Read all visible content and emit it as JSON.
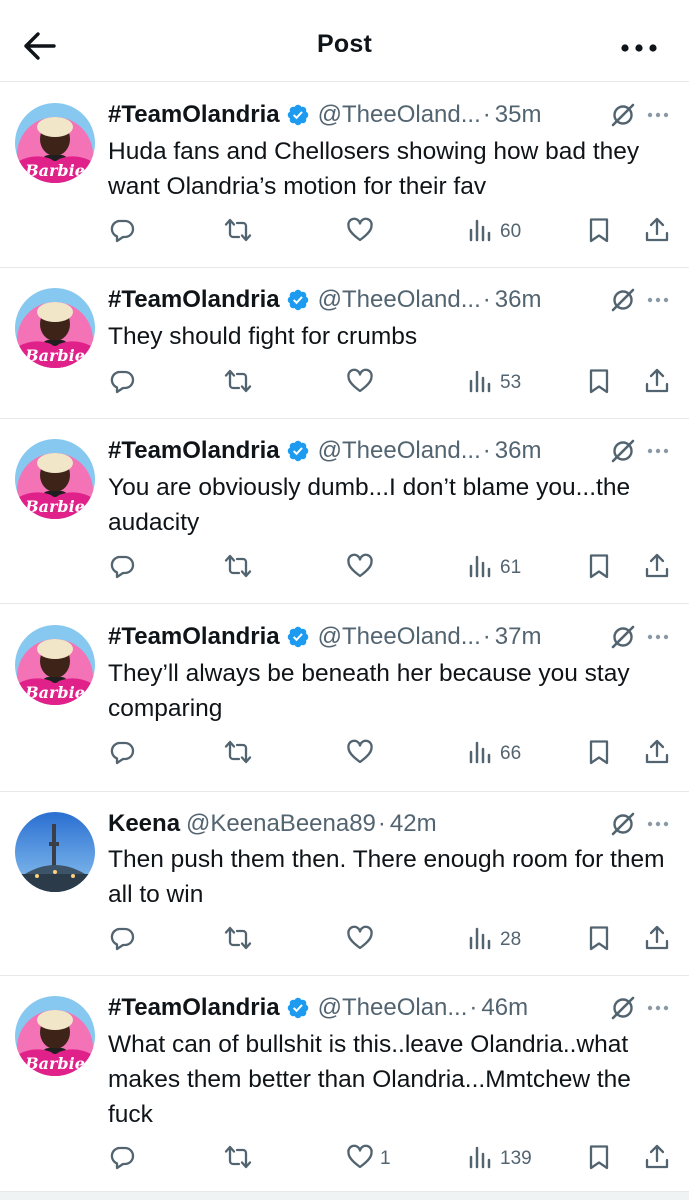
{
  "header": {
    "title": "Post"
  },
  "tweets": [
    {
      "name": "#TeamOlandria",
      "verified": true,
      "handle": "@TheeOland...",
      "time": "35m",
      "text": "Huda fans and Chellosers showing how bad they want Olandria’s motion for their fav",
      "likes": "",
      "views": "60",
      "avatar": "barbie"
    },
    {
      "name": "#TeamOlandria",
      "verified": true,
      "handle": "@TheeOland...",
      "time": "36m",
      "text": "They should fight for crumbs",
      "likes": "",
      "views": "53",
      "avatar": "barbie"
    },
    {
      "name": "#TeamOlandria",
      "verified": true,
      "handle": "@TheeOland...",
      "time": "36m",
      "text": "You are obviously dumb...I don’t blame you...the audacity",
      "likes": "",
      "views": "61",
      "avatar": "barbie"
    },
    {
      "name": "#TeamOlandria",
      "verified": true,
      "handle": "@TheeOland...",
      "time": "37m",
      "text": "They’ll always be beneath her because you stay comparing",
      "likes": "",
      "views": "66",
      "avatar": "barbie"
    },
    {
      "name": "Keena",
      "verified": false,
      "handle": "@KeenaBeena89",
      "time": "42m",
      "text": "Then push them then. There enough room for them all to win",
      "likes": "",
      "views": "28",
      "avatar": "tower"
    },
    {
      "name": "#TeamOlandria",
      "verified": true,
      "handle": "@TheeOlan...",
      "time": "46m",
      "text": "What can of bullshit is this..leave Olandria..what makes them better than Olandria...Mmtchew the fuck",
      "likes": "1",
      "views": "139",
      "avatar": "barbie"
    }
  ],
  "avatar_labels": {
    "barbie": "Barbie"
  },
  "colors": {
    "verified": "#1d9bf0",
    "secondary_text": "#536471",
    "barbie_pink": "#e0218a"
  },
  "icons": {
    "back": "arrow-left-icon",
    "more": "more-horizontal-icon",
    "reply": "reply-icon",
    "retweet": "retweet-icon",
    "like": "heart-icon",
    "views": "views-bar-chart-icon",
    "bookmark": "bookmark-icon",
    "share": "share-icon",
    "grok": "grok-icon"
  }
}
